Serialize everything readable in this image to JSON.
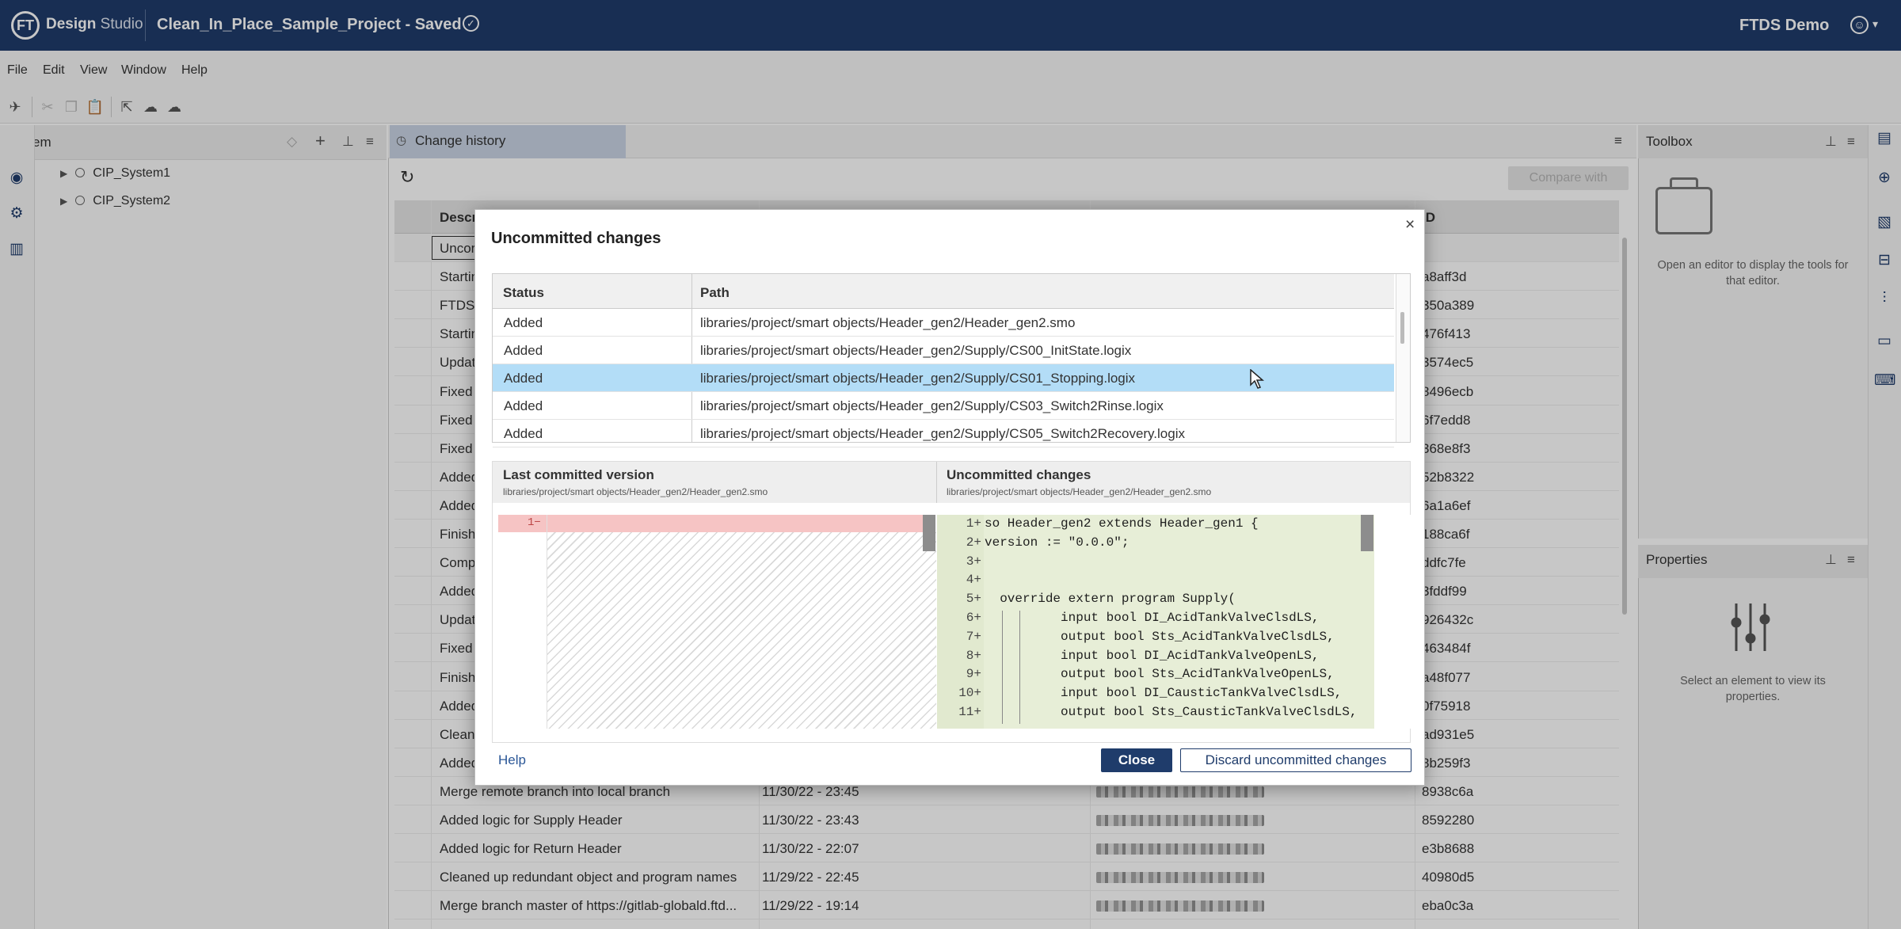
{
  "titlebar": {
    "logo_badge": "FT",
    "logo_text_bold": "Design",
    "logo_text_light": "Studio",
    "project_title": "Clean_In_Place_Sample_Project - Saved",
    "saved_icon": "check-circle-icon",
    "user_name": "FTDS Demo"
  },
  "menu": [
    "File",
    "Edit",
    "View",
    "Window",
    "Help"
  ],
  "system_panel": {
    "title": "System",
    "tree": [
      "CIP_System1",
      "CIP_System2"
    ]
  },
  "center": {
    "tab_label": "Change history",
    "compare_label": "Compare with",
    "columns": [
      "Descr",
      "",
      "",
      "ID"
    ],
    "rows": [
      {
        "desc": "Uncor",
        "date": "",
        "id": ""
      },
      {
        "desc": "Startin",
        "date": "",
        "id": "a8aff3d"
      },
      {
        "desc": "FTDS:",
        "date": "",
        "id": "350a389"
      },
      {
        "desc": "Startin",
        "date": "",
        "id": "476f413"
      },
      {
        "desc": "Updat",
        "date": "",
        "id": "3574ec5"
      },
      {
        "desc": "Fixed",
        "date": "",
        "id": "8496ecb"
      },
      {
        "desc": "Fixed",
        "date": "",
        "id": "6f7edd8"
      },
      {
        "desc": "Fixed",
        "date": "",
        "id": "368e8f3"
      },
      {
        "desc": "Added",
        "date": "",
        "id": "52b8322"
      },
      {
        "desc": "Added",
        "date": "",
        "id": "6a1a6ef"
      },
      {
        "desc": "Finish",
        "date": "",
        "id": "188ca6f"
      },
      {
        "desc": "Comp",
        "date": "",
        "id": "ddfc7fe"
      },
      {
        "desc": "Added",
        "date": "",
        "id": "3fddf99"
      },
      {
        "desc": "Updat",
        "date": "",
        "id": "926432c"
      },
      {
        "desc": "Fixed",
        "date": "",
        "id": "463484f"
      },
      {
        "desc": "Finish",
        "date": "",
        "id": "a48f077"
      },
      {
        "desc": "Added",
        "date": "",
        "id": "0f75918"
      },
      {
        "desc": "Clean",
        "date": "",
        "id": "ad931e5"
      },
      {
        "desc": "Added",
        "date": "",
        "id": "8b259f3"
      },
      {
        "desc": "Merge remote branch into local branch",
        "date": "11/30/22 - 23:45",
        "id": "8938c6a"
      },
      {
        "desc": "Added logic for Supply Header",
        "date": "11/30/22 - 23:43",
        "id": "8592280"
      },
      {
        "desc": "Added logic for Return Header",
        "date": "11/30/22 - 22:07",
        "id": "e3b8688"
      },
      {
        "desc": "Cleaned up redundant object and program names",
        "date": "11/29/22 - 22:45",
        "id": "40980d5"
      },
      {
        "desc": "Merge branch master of https://gitlab-globald.ftd...",
        "date": "11/29/22 - 19:14",
        "id": "eba0c3a"
      }
    ]
  },
  "toolbox": {
    "title": "Toolbox",
    "message": "Open an editor to display the tools for that editor."
  },
  "properties": {
    "title": "Properties",
    "message": "Select an element to view its properties."
  },
  "modal": {
    "title": "Uncommitted changes",
    "table_headers": {
      "status": "Status",
      "path": "Path"
    },
    "files": [
      {
        "status": "Added",
        "path": "libraries/project/smart objects/Header_gen2/Header_gen2.smo",
        "selected": false
      },
      {
        "status": "Added",
        "path": "libraries/project/smart objects/Header_gen2/Supply/CS00_InitState.logix",
        "selected": false
      },
      {
        "status": "Added",
        "path": "libraries/project/smart objects/Header_gen2/Supply/CS01_Stopping.logix",
        "selected": true
      },
      {
        "status": "Added",
        "path": "libraries/project/smart objects/Header_gen2/Supply/CS03_Switch2Rinse.logix",
        "selected": false
      },
      {
        "status": "Added",
        "path": "libraries/project/smart objects/Header_gen2/Supply/CS05_Switch2Recovery.logix",
        "selected": false
      }
    ],
    "diff": {
      "left_title": "Last committed version",
      "left_path": "libraries/project/smart objects/Header_gen2/Header_gen2.smo",
      "left_line": "1−",
      "right_title": "Uncommitted changes",
      "right_path": "libraries/project/smart objects/Header_gen2/Header_gen2.smo",
      "lines": [
        {
          "ln": "1+",
          "text": "so Header_gen2 extends Header_gen1 {"
        },
        {
          "ln": "2+",
          "text": "version := \"0.0.0\";"
        },
        {
          "ln": "3+",
          "text": ""
        },
        {
          "ln": "4+",
          "text": ""
        },
        {
          "ln": "5+",
          "text": "  override extern program Supply("
        },
        {
          "ln": "6+",
          "text": "          input bool DI_AcidTankValveClsdLS,"
        },
        {
          "ln": "7+",
          "text": "          output bool Sts_AcidTankValveClsdLS,"
        },
        {
          "ln": "8+",
          "text": "          input bool DI_AcidTankValveOpenLS,"
        },
        {
          "ln": "9+",
          "text": "          output bool Sts_AcidTankValveOpenLS,"
        },
        {
          "ln": "10+",
          "text": "          input bool DI_CausticTankValveClsdLS,"
        },
        {
          "ln": "11+",
          "text": "          output bool Sts_CausticTankValveClsdLS,"
        }
      ]
    },
    "help_label": "Help",
    "close_label": "Close",
    "discard_label": "Discard uncommitted changes"
  }
}
